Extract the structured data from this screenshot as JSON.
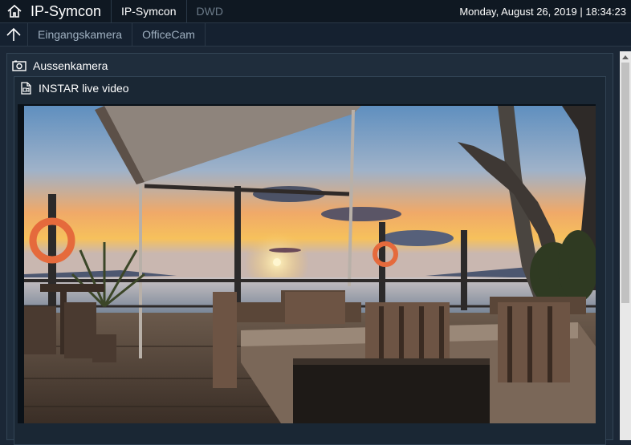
{
  "topbar": {
    "brand": "IP-Symcon",
    "tabs": [
      {
        "label": "IP-Symcon",
        "active": true
      },
      {
        "label": "DWD",
        "active": false
      }
    ],
    "datetime": "Monday, August 26, 2019 | 18:34:23"
  },
  "subbar": {
    "tabs": [
      "Eingangskamera",
      "OfficeCam"
    ]
  },
  "panel": {
    "title": "Aussenkamera",
    "media": {
      "title": "INSTAR live video"
    }
  },
  "colors": {
    "background": "#1b2736",
    "topbar": "#0f1822",
    "accent_text": "#ffffff",
    "dim_text": "#6b7a88"
  }
}
